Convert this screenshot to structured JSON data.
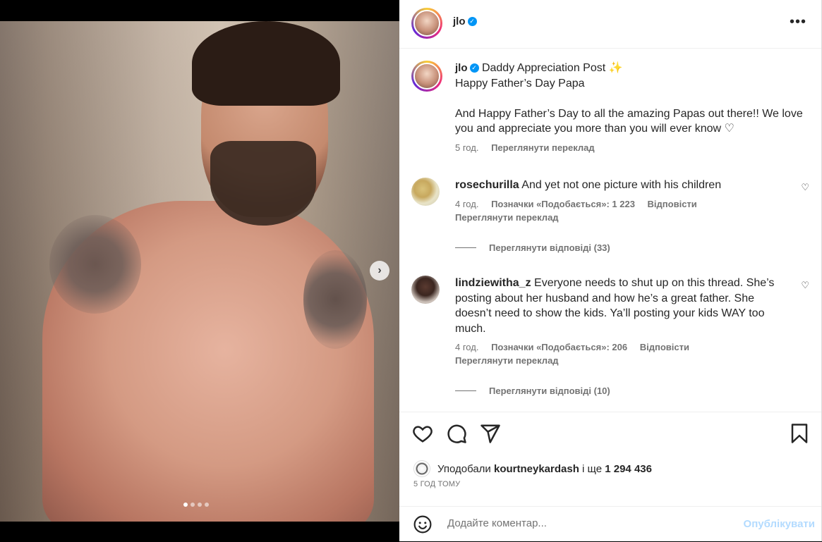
{
  "post": {
    "username": "jlo",
    "more_icon": "more-horizontal-icon",
    "image_dots": [
      true,
      false,
      false,
      false
    ]
  },
  "caption": {
    "username": "jlo",
    "title": "Daddy Appreciation Post ✨",
    "line1": "Happy Father’s Day Papa",
    "line2": "And Happy Father’s Day to all the amazing Papas out there!! We love you and appreciate you more than you will ever know ♡",
    "time": "5 год.",
    "translate": "Переглянути переклад"
  },
  "comments": [
    {
      "username": "rosechurilla",
      "text": "And yet not one picture with his children",
      "time": "4 год.",
      "likes": "Позначки «Подобається»: 1 223",
      "reply": "Відповісти",
      "translate": "Переглянути переклад",
      "replies": "Переглянути відповіді (33)"
    },
    {
      "username": "lindziewitha_z",
      "text": "Everyone needs to shut up on this thread. She’s posting about her husband and how he’s a great father. She doesn’t need to show the kids. Ya’ll posting your kids WAY too much.",
      "time": "4 год.",
      "likes": "Позначки «Подобається»: 206",
      "reply": "Відповісти",
      "translate": "Переглянути переклад",
      "replies": "Переглянути відповіді (10)"
    }
  ],
  "likes": {
    "prefix": "Уподобали",
    "user": "kourtneykardash",
    "and": "і ще",
    "count": "1 294 436"
  },
  "timestamp": "5 ГОД ТОМУ",
  "add_comment": {
    "placeholder": "Додайте коментар...",
    "post_label": "Опублікувати"
  }
}
